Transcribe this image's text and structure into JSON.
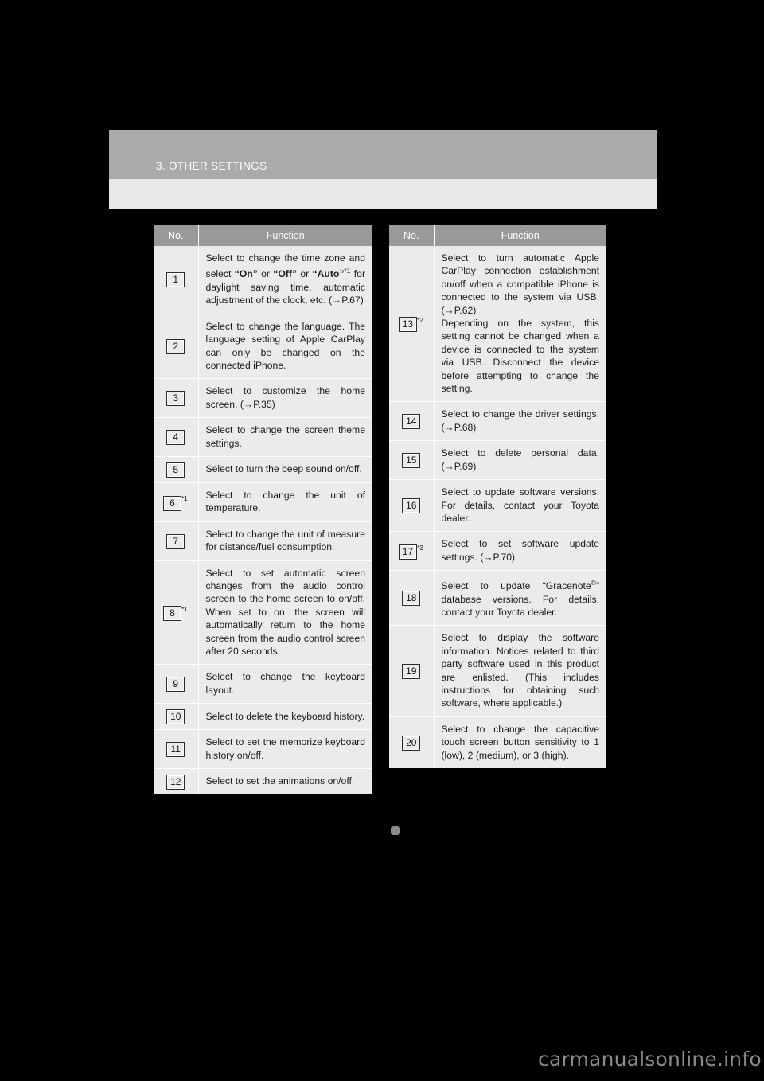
{
  "page": {
    "chapter_title": "3. OTHER SETTINGS",
    "watermark": "carmanualsonline.info",
    "colors": {
      "header_band": "#aaaaaa",
      "header_subband": "#e9e9e9",
      "table_header": "#999999",
      "table_body": "#ebebeb",
      "page_background": "#000000"
    }
  },
  "table_left": {
    "headers": {
      "no": "No.",
      "function": "Function"
    },
    "rows": [
      {
        "no": "1",
        "no_footnote": "",
        "function_parts": [
          {
            "type": "text",
            "value": "Select to change the time zone and select "
          },
          {
            "type": "bold",
            "value": "“On”"
          },
          {
            "type": "text",
            "value": " or "
          },
          {
            "type": "bold",
            "value": "“Off”"
          },
          {
            "type": "text",
            "value": " or "
          },
          {
            "type": "bold",
            "value": "“Auto”"
          },
          {
            "type": "sup",
            "value": "*1"
          },
          {
            "type": "text",
            "value": " for daylight saving time, automatic adjustment of the clock, etc. (→P.67)"
          }
        ],
        "function_plain": "Select to change the time zone and select “On” or “Off” or “Auto”*1 for daylight saving time, automatic adjustment of the clock, etc. (→P.67)"
      },
      {
        "no": "2",
        "no_footnote": "",
        "function_plain": "Select to change the language. The language setting of Apple CarPlay can only be changed on the connected iPhone."
      },
      {
        "no": "3",
        "no_footnote": "",
        "function_plain": "Select to customize the home screen. (→P.35)"
      },
      {
        "no": "4",
        "no_footnote": "",
        "function_plain": "Select to change the screen theme settings."
      },
      {
        "no": "5",
        "no_footnote": "",
        "function_plain": "Select to turn the beep sound on/off."
      },
      {
        "no": "6",
        "no_footnote": "*1",
        "function_plain": "Select to change the unit of temperature."
      },
      {
        "no": "7",
        "no_footnote": "",
        "function_plain": "Select to change the unit of measure for distance/fuel consumption."
      },
      {
        "no": "8",
        "no_footnote": "*1",
        "function_plain": "Select to set automatic screen changes from the audio control screen to the home screen to on/off. When set to on, the screen will automatically return to the home screen from the audio control screen after 20 seconds."
      },
      {
        "no": "9",
        "no_footnote": "",
        "function_plain": "Select to change the keyboard layout."
      },
      {
        "no": "10",
        "no_footnote": "",
        "function_plain": "Select to delete the keyboard history."
      },
      {
        "no": "11",
        "no_footnote": "",
        "function_plain": "Select to set the memorize keyboard history on/off."
      },
      {
        "no": "12",
        "no_footnote": "",
        "function_plain": "Select to set the animations on/off."
      }
    ]
  },
  "table_right": {
    "headers": {
      "no": "No.",
      "function": "Function"
    },
    "rows": [
      {
        "no": "13",
        "no_footnote": "*2",
        "function_plain": "Select to turn automatic Apple CarPlay connection establishment on/off when a compatible iPhone is connected to the system via USB. (→P.62)\nDepending on the system, this setting cannot be changed when a device is connected to the system via USB. Disconnect the device before attempting to change the setting.",
        "function_line_1": "Select to turn automatic Apple CarPlay connection establishment on/off when a compatible iPhone is connected to the system via USB. (→P.62)",
        "function_line_2": "Depending on the system, this setting cannot be changed when a device is connected to the system via USB. Disconnect the device before attempting to change the setting."
      },
      {
        "no": "14",
        "no_footnote": "",
        "function_plain": "Select to change the driver settings. (→P.68)"
      },
      {
        "no": "15",
        "no_footnote": "",
        "function_plain": "Select to delete personal data. (→P.69)"
      },
      {
        "no": "16",
        "no_footnote": "",
        "function_plain": "Select to update software versions. For details, contact your Toyota dealer."
      },
      {
        "no": "17",
        "no_footnote": "*3",
        "function_plain": "Select to set software update settings. (→P.70)"
      },
      {
        "no": "18",
        "no_footnote": "",
        "function_prefix": "Select to update “Gracenote",
        "function_reg": "®",
        "function_suffix": "” database versions. For details, contact your Toyota dealer.",
        "function_plain": "Select to update “Gracenote®” database versions. For details, contact your Toyota dealer."
      },
      {
        "no": "19",
        "no_footnote": "",
        "function_plain": "Select to display the software information. Notices related to third party software used in this product are enlisted. (This includes instructions for obtaining such software, where applicable.)"
      },
      {
        "no": "20",
        "no_footnote": "",
        "function_plain": "Select to change the capacitive touch screen button sensitivity to 1 (low), 2 (medium), or 3 (high)."
      }
    ]
  }
}
